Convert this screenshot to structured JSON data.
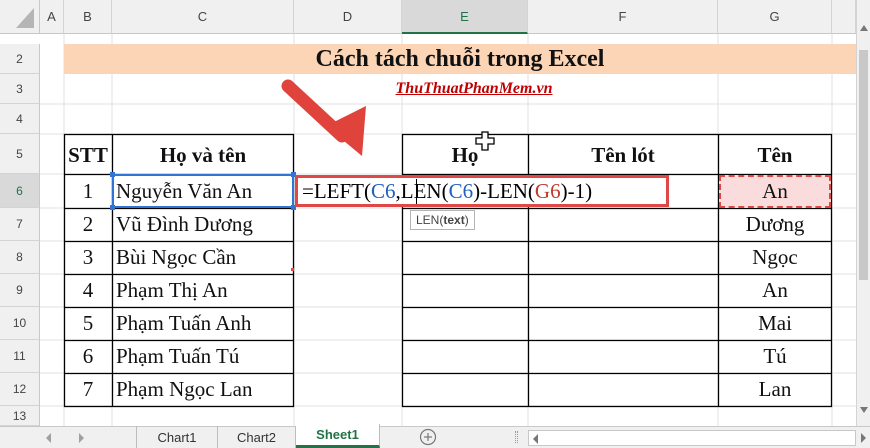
{
  "columns": [
    "A",
    "B",
    "C",
    "D",
    "E",
    "F",
    "G"
  ],
  "rows": [
    "2",
    "3",
    "4",
    "5",
    "6",
    "7",
    "8",
    "9",
    "10",
    "11",
    "12",
    "13"
  ],
  "title": "Cách tách chuỗi trong Excel",
  "subtitle": "ThuThuatPhanMem.vn",
  "headers": {
    "stt": "STT",
    "name": "Họ và tên",
    "ho": "Họ",
    "tenlot": "Tên lót",
    "ten": "Tên"
  },
  "data_rows": [
    {
      "stt": "1",
      "name": "Nguyễn Văn An",
      "ten": "An"
    },
    {
      "stt": "2",
      "name": "Vũ Đình Dương",
      "ten": "Dương"
    },
    {
      "stt": "3",
      "name": "Bùi Ngọc Cần",
      "ten": "Ngọc"
    },
    {
      "stt": "4",
      "name": "Phạm Thị An",
      "ten": "An"
    },
    {
      "stt": "5",
      "name": "Phạm Tuấn Anh",
      "ten": "Mai"
    },
    {
      "stt": "6",
      "name": "Phạm Tuấn Tú",
      "ten": "Tú"
    },
    {
      "stt": "7",
      "name": "Phạm Ngọc Lan",
      "ten": "Lan"
    }
  ],
  "formula": {
    "p1": "=LEFT(",
    "p2": "C6",
    "p3": ",LEN(",
    "p4": "C6",
    "p5": ")-LEN(",
    "p6": "G6",
    "p7": ")-1)"
  },
  "tooltip": {
    "fn": "LEN(",
    "arg": "text",
    "close": ")"
  },
  "sheet_tabs": [
    "Chart1",
    "Chart2",
    "Sheet1"
  ],
  "active_tab": "Sheet1",
  "icons": [
    "select-all-icon",
    "scroll-left-icon",
    "scroll-right-icon",
    "add-sheet-icon",
    "scroll-up-icon",
    "scroll-down-icon",
    "cursor-icon",
    "arrow-annotation-icon"
  ],
  "colors": {
    "title_bg": "#fbd5b5",
    "ref_blue": "#1f5fbf",
    "ref_red": "#c0392b",
    "highlight_red": "#e04848",
    "excel_green": "#217346"
  }
}
